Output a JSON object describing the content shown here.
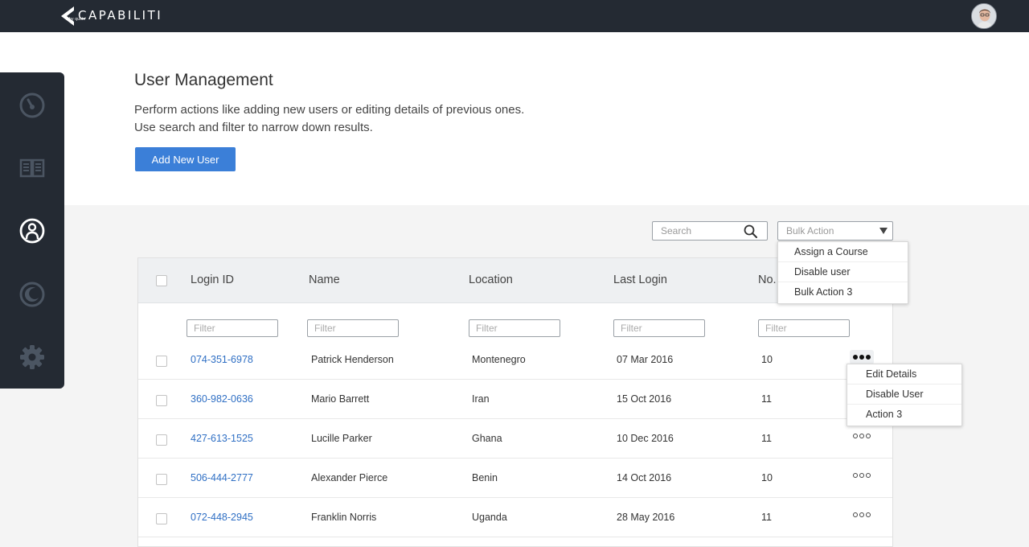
{
  "app": {
    "brand": "CAPABILITI",
    "brand_sub": "by qustn"
  },
  "sidebar": {
    "items": [
      {
        "name": "dashboard",
        "icon": "gauge-icon"
      },
      {
        "name": "courses",
        "icon": "book-icon"
      },
      {
        "name": "users",
        "icon": "user-icon",
        "active": true
      },
      {
        "name": "reports",
        "icon": "moon-icon"
      },
      {
        "name": "settings",
        "icon": "gear-icon"
      }
    ]
  },
  "page": {
    "title": "User Management",
    "desc_line1": "Perform actions like adding new users or editing details of previous ones.",
    "desc_line2": "Use search and filter to narrow down results.",
    "add_button": "Add New User"
  },
  "toolbar": {
    "search_placeholder": "Search",
    "bulk_placeholder": "Bulk Action",
    "bulk_options": [
      "Assign a Course",
      "Disable user",
      "Bulk Action 3"
    ]
  },
  "table": {
    "columns": [
      "Login ID",
      "Name",
      "Location",
      "Last Login",
      "No."
    ],
    "filter_placeholder": "Filter",
    "rows": [
      {
        "login_id": "074-351-6978",
        "name": "Patrick Henderson",
        "location": "Montenegro",
        "last_login": "07 Mar 2016",
        "no": "10"
      },
      {
        "login_id": "360-982-0636",
        "name": "Mario Barrett",
        "location": "Iran",
        "last_login": "15 Oct 2016",
        "no": "11"
      },
      {
        "login_id": "427-613-1525",
        "name": "Lucille Parker",
        "location": "Ghana",
        "last_login": "10 Dec 2016",
        "no": "11"
      },
      {
        "login_id": "506-444-2777",
        "name": "Alexander Pierce",
        "location": "Benin",
        "last_login": "14 Oct 2016",
        "no": "10"
      },
      {
        "login_id": "072-448-2945",
        "name": "Franklin Norris",
        "location": "Uganda",
        "last_login": "28 May 2016",
        "no": "11"
      }
    ]
  },
  "row_menu": {
    "items": [
      "Edit Details",
      "Disable User",
      "Action 3"
    ]
  },
  "colors": {
    "topbar": "#242a33",
    "accent": "#3b7fd8",
    "link": "#2f6fc4"
  }
}
